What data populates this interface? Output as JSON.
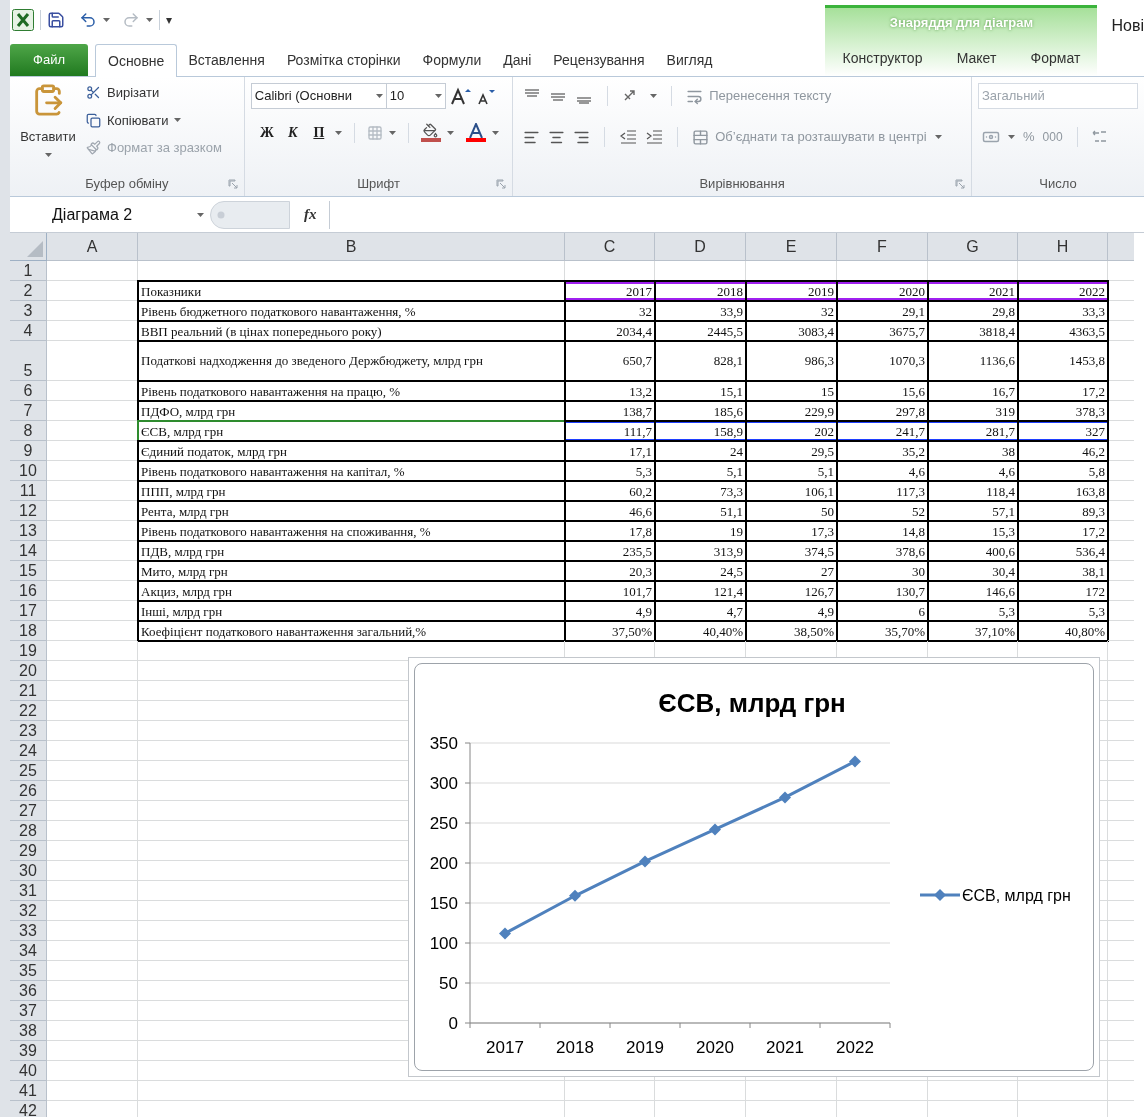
{
  "quick_access": {
    "customize_caret": "▾"
  },
  "tabs": [
    {
      "label": "Файл",
      "kind": "file",
      "selected": false
    },
    {
      "label": "Основне",
      "kind": "tab",
      "selected": true
    },
    {
      "label": "Вставлення",
      "kind": "tab",
      "selected": false
    },
    {
      "label": "Розмітка сторінки",
      "kind": "tab",
      "selected": false
    },
    {
      "label": "Формули",
      "kind": "tab",
      "selected": false
    },
    {
      "label": "Дані",
      "kind": "tab",
      "selected": false
    },
    {
      "label": "Рецензування",
      "kind": "tab",
      "selected": false
    },
    {
      "label": "Вигляд",
      "kind": "tab",
      "selected": false
    }
  ],
  "contextual": {
    "title": "Знаряддя для діаграм",
    "tabs": [
      {
        "label": "Конструктор",
        "selected": false
      },
      {
        "label": "Макет",
        "selected": false
      },
      {
        "label": "Формат",
        "selected": false
      }
    ]
  },
  "title_fragment": "Нові",
  "clipboard": {
    "paste": "Вставити",
    "cut": "Вирізати",
    "copy": "Копіювати",
    "format_painter": {
      "label": "Формат за зразком",
      "disabled": true
    },
    "group": "Буфер обміну"
  },
  "font": {
    "name": "Calibri (Основни",
    "size": "10",
    "bold": "Ж",
    "italic": "К",
    "underline": "П",
    "group": "Шрифт"
  },
  "alignment": {
    "wrap": {
      "label": "Перенесення тексту",
      "disabled": true
    },
    "merge": {
      "label": "Об’єднати та розташувати в центрі",
      "disabled": true
    },
    "group": "Вирівнювання"
  },
  "number": {
    "format": {
      "label": "Загальний",
      "disabled": true
    },
    "percent": "%",
    "thousands": "000",
    "group": "Число"
  },
  "formula_bar": {
    "name_box": "Діаграма 2",
    "function_label": "fx"
  },
  "columns": [
    "A",
    "B",
    "C",
    "D",
    "E",
    "F",
    "G",
    "H"
  ],
  "row_numbers": [
    "1",
    "2",
    "3",
    "4",
    "5",
    "6",
    "7",
    "8",
    "9",
    "10",
    "11",
    "12",
    "13",
    "14",
    "15",
    "16",
    "17",
    "18",
    "19",
    "20",
    "21",
    "22",
    "23",
    "24",
    "25",
    "26",
    "27",
    "28",
    "29",
    "30",
    "31",
    "32",
    "33",
    "34",
    "35",
    "36",
    "37",
    "38",
    "39",
    "40",
    "41",
    "42"
  ],
  "table": {
    "rows": [
      {
        "label": "Показники",
        "values": [
          "2017",
          "2018",
          "2019",
          "2020",
          "2021",
          "2022"
        ],
        "category_range": true,
        "series_range": false
      },
      {
        "label": "Рівень бюджетного податкового навантаження, %",
        "values": [
          "32",
          "33,9",
          "32",
          "29,1",
          "29,8",
          "33,3"
        ],
        "category_range": false,
        "series_range": false
      },
      {
        "label": "ВВП реальний (в цінах попереднього року)",
        "values": [
          "2034,4",
          "2445,5",
          "3083,4",
          "3675,7",
          "3818,4",
          "4363,5"
        ],
        "category_range": false,
        "series_range": false
      },
      {
        "label": "Податкові надходження до зведеного Держбюджету, млрд грн",
        "values": [
          "650,7",
          "828,1",
          "986,3",
          "1070,3",
          "1136,6",
          "1453,8"
        ],
        "category_range": false,
        "series_range": false
      },
      {
        "label": "Рівень податкового навантаження на працю, %",
        "values": [
          "13,2",
          "15,1",
          "15",
          "15,6",
          "16,7",
          "17,2"
        ],
        "category_range": false,
        "series_range": false
      },
      {
        "label": "ПДФО, млрд грн",
        "values": [
          "138,7",
          "185,6",
          "229,9",
          "297,8",
          "319",
          "378,3"
        ],
        "category_range": false,
        "series_range": false
      },
      {
        "label": "ЄСВ, млрд грн",
        "values": [
          "111,7",
          "158,9",
          "202",
          "241,7",
          "281,7",
          "327"
        ],
        "category_range": false,
        "series_range": true
      },
      {
        "label": "Єдиний податок, млрд грн",
        "values": [
          "17,1",
          "24",
          "29,5",
          "35,2",
          "38",
          "46,2"
        ],
        "category_range": false,
        "series_range": false
      },
      {
        "label": "Рівень податкового навантаження на капітал, %",
        "values": [
          "5,3",
          "5,1",
          "5,1",
          "4,6",
          "4,6",
          "5,8"
        ],
        "category_range": false,
        "series_range": false
      },
      {
        "label": "ППП, млрд грн",
        "values": [
          "60,2",
          "73,3",
          "106,1",
          "117,3",
          "118,4",
          "163,8"
        ],
        "category_range": false,
        "series_range": false
      },
      {
        "label": "Рента, млрд грн",
        "values": [
          "46,6",
          "51,1",
          "50",
          "52",
          "57,1",
          "89,3"
        ],
        "category_range": false,
        "series_range": false
      },
      {
        "label": "Рівень податкового навантаження на споживання, %",
        "values": [
          "17,8",
          "19",
          "17,3",
          "14,8",
          "15,3",
          "17,2"
        ],
        "category_range": false,
        "series_range": false
      },
      {
        "label": "ПДВ, млрд грн",
        "values": [
          "235,5",
          "313,9",
          "374,5",
          "378,6",
          "400,6",
          "536,4"
        ],
        "category_range": false,
        "series_range": false
      },
      {
        "label": "Мито, млрд грн",
        "values": [
          "20,3",
          "24,5",
          "27",
          "30",
          "30,4",
          "38,1"
        ],
        "category_range": false,
        "series_range": false
      },
      {
        "label": "Акциз, млрд грн",
        "values": [
          "101,7",
          "121,4",
          "126,7",
          "130,7",
          "146,6",
          "172"
        ],
        "category_range": false,
        "series_range": false
      },
      {
        "label": "Інші, млрд грн",
        "values": [
          "4,9",
          "4,7",
          "4,9",
          "6",
          "5,3",
          "5,3"
        ],
        "category_range": false,
        "series_range": false
      },
      {
        "label": "Коефіцієнт податкового навантаження загальний,%",
        "values": [
          "37,50%",
          "40,40%",
          "38,50%",
          "35,70%",
          "37,10%",
          "40,80%"
        ],
        "category_range": false,
        "series_range": false
      }
    ]
  },
  "chart": {
    "chart_data": {
      "type": "line",
      "title": "ЄСВ, млрд грн",
      "categories": [
        "2017",
        "2018",
        "2019",
        "2020",
        "2021",
        "2022"
      ],
      "series": [
        {
          "name": "ЄСВ, млрд грн",
          "color": "#4f81bd",
          "marker": "diamond",
          "values": [
            112,
            159,
            202,
            242,
            282,
            327
          ]
        }
      ],
      "ylim": [
        0,
        350
      ],
      "yticks": [
        0,
        50,
        100,
        150,
        200,
        250,
        300,
        350
      ],
      "grid": true
    }
  }
}
